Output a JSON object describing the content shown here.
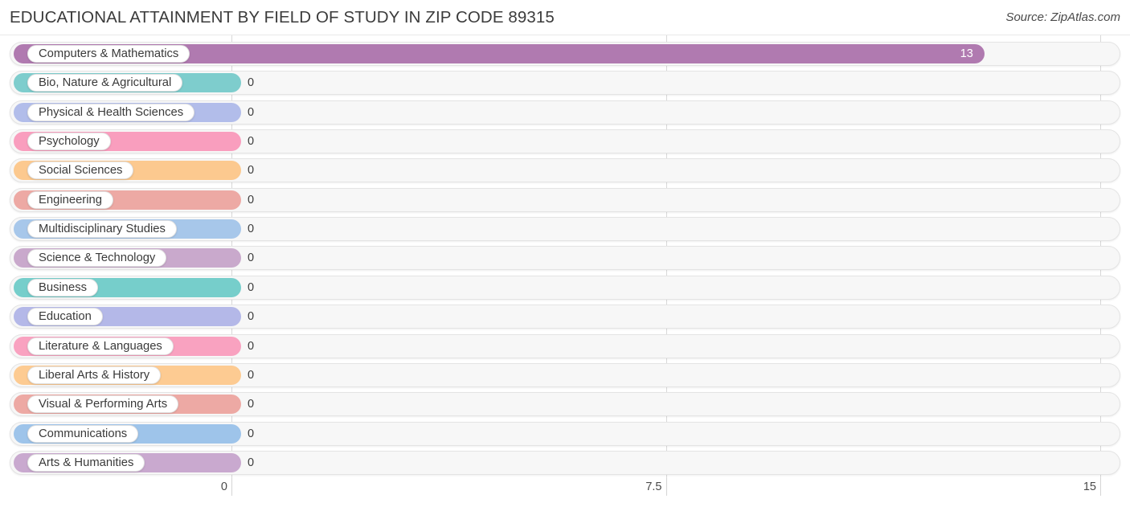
{
  "header": {
    "title": "EDUCATIONAL ATTAINMENT BY FIELD OF STUDY IN ZIP CODE 89315",
    "source": "Source: ZipAtlas.com"
  },
  "chart_data": {
    "type": "bar",
    "orientation": "horizontal",
    "title": "EDUCATIONAL ATTAINMENT BY FIELD OF STUDY IN ZIP CODE 89315",
    "xlabel": "",
    "ylabel": "",
    "xlim": [
      0,
      15
    ],
    "ticks": [
      "0",
      "7.5",
      "15"
    ],
    "tick_values": [
      0,
      7.5,
      15
    ],
    "grid": true,
    "legend": "none",
    "categories": [
      "Computers & Mathematics",
      "Bio, Nature & Agricultural",
      "Physical & Health Sciences",
      "Psychology",
      "Social Sciences",
      "Engineering",
      "Multidisciplinary Studies",
      "Science & Technology",
      "Business",
      "Education",
      "Literature & Languages",
      "Liberal Arts & History",
      "Visual & Performing Arts",
      "Communications",
      "Arts & Humanities"
    ],
    "values": [
      13,
      0,
      0,
      0,
      0,
      0,
      0,
      0,
      0,
      0,
      0,
      0,
      0,
      0,
      0
    ],
    "value_labels": [
      "13",
      "0",
      "0",
      "0",
      "0",
      "0",
      "0",
      "0",
      "0",
      "0",
      "0",
      "0",
      "0",
      "0",
      "0"
    ],
    "colors": [
      "#b07ab0",
      "#7ecdcd",
      "#b2bdea",
      "#f99ebe",
      "#fcc98f",
      "#eda9a4",
      "#a7c7ea",
      "#c9a9cc",
      "#76cecb",
      "#b4b8e8",
      "#f9a2c0",
      "#fdcb92",
      "#eda9a4",
      "#9ec4ea",
      "#c9a9cf"
    ]
  }
}
